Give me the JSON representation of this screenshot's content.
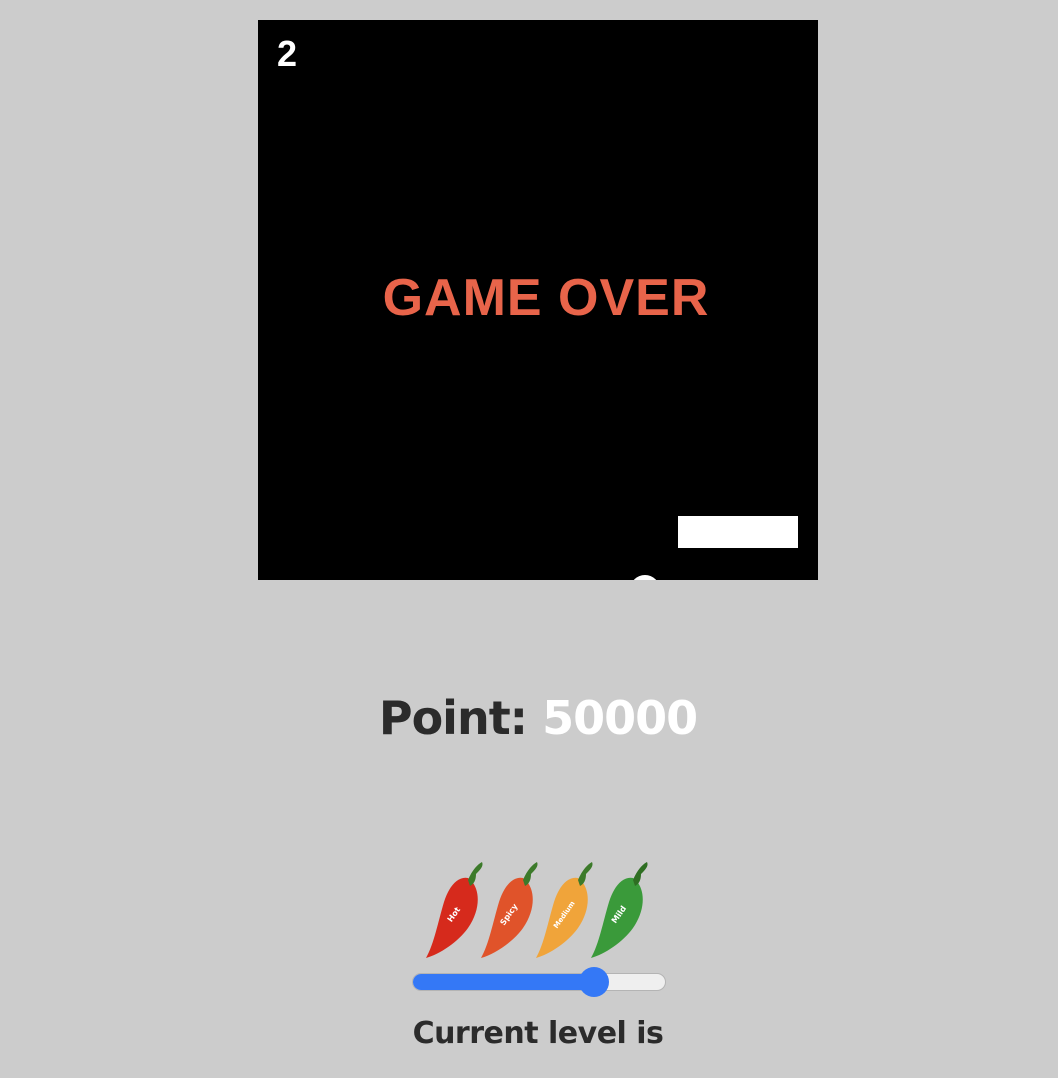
{
  "game": {
    "lives": "2",
    "status_text": "GAME OVER",
    "background_color": "#000000",
    "status_color": "#e8644a"
  },
  "score": {
    "label": "Point:",
    "value": "50000"
  },
  "level_selector": {
    "peppers": [
      {
        "label": "Hot",
        "color": "#d62a1c"
      },
      {
        "label": "Spicy",
        "color": "#e0532a"
      },
      {
        "label": "Medium",
        "color": "#f0a43a"
      },
      {
        "label": "Mild",
        "color": "#3a9a3a"
      }
    ],
    "slider_value": 0.72,
    "slider_color": "#3478f6",
    "label": "Current level is"
  }
}
